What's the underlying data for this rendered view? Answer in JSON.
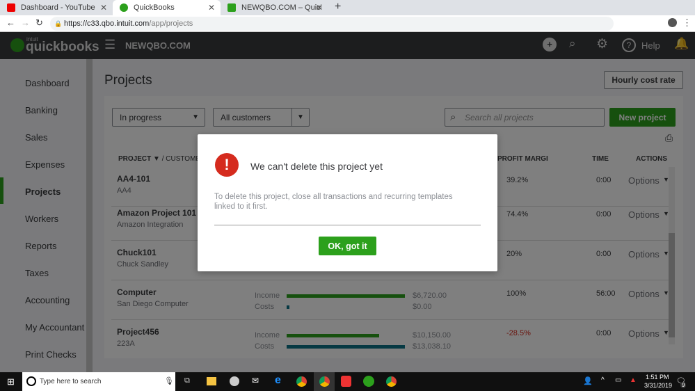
{
  "browser": {
    "tabs": [
      {
        "label": "Dashboard - YouTube"
      },
      {
        "label": "QuickBooks"
      },
      {
        "label": "NEWQBO.COM – QuickBooks Or"
      }
    ],
    "url_host": "https://c33.qbo.intuit.com",
    "url_path": "/app/projects"
  },
  "header": {
    "logo_small": "intuit",
    "logo": "quickbooks",
    "company": "NEWQBO.COM",
    "help": "Help"
  },
  "sidebar": {
    "items": [
      {
        "label": "Dashboard"
      },
      {
        "label": "Banking"
      },
      {
        "label": "Sales"
      },
      {
        "label": "Expenses"
      },
      {
        "label": "Projects"
      },
      {
        "label": "Workers"
      },
      {
        "label": "Reports"
      },
      {
        "label": "Taxes"
      },
      {
        "label": "Accounting"
      },
      {
        "label": "My Accountant"
      },
      {
        "label": "Print Checks"
      }
    ]
  },
  "page": {
    "title": "Projects",
    "hourly_cost_rate": "Hourly cost rate",
    "status_filter": "In progress",
    "customer_filter": "All customers",
    "search_placeholder": "Search all projects",
    "new_project": "New project"
  },
  "table": {
    "headers": {
      "project": "PROJECT",
      "customer": "/ CUSTOMER",
      "profit": "PROFIT MARGI",
      "time": "TIME",
      "actions": "ACTIONS"
    },
    "rows": [
      {
        "name": "AA4-101",
        "customer": "AA4",
        "margin": "39.2%",
        "time": "0:00",
        "action": "Options"
      },
      {
        "name": "Amazon Project 101",
        "customer": "Amazon Integration",
        "margin": "74.4%",
        "time": "0:00",
        "action": "Options"
      },
      {
        "name": "Chuck101",
        "customer": "Chuck Sandley",
        "margin": "20%",
        "time": "0:00",
        "action": "Options"
      },
      {
        "name": "Computer",
        "customer": "San Diego Computer",
        "income_label": "Income",
        "costs_label": "Costs",
        "income": "$6,720.00",
        "costs": "$0.00",
        "income_frac": 1.0,
        "costs_frac": 0.02,
        "margin": "100%",
        "time": "56:00",
        "action": "Options"
      },
      {
        "name": "Project456",
        "customer": "223A",
        "income_label": "Income",
        "costs_label": "Costs",
        "income": "$10,150.00",
        "costs": "$13,038.10",
        "income_frac": 0.78,
        "costs_frac": 1.0,
        "margin": "-28.5%",
        "time": "0:00",
        "action": "Options"
      }
    ]
  },
  "dialog": {
    "title": "We can't delete this project yet",
    "message": "To delete this project, close all transactions and recurring templates linked to it first.",
    "ok": "OK, got it"
  },
  "taskbar": {
    "search": "Type here to search",
    "time": "1:51 PM",
    "date": "3/31/2019",
    "notif": "9"
  },
  "colors": {
    "green": "#2ca01c",
    "error": "#d52b1e",
    "income": "#2ca01c",
    "costs": "#0d7286",
    "negative": "#d52b1e"
  }
}
